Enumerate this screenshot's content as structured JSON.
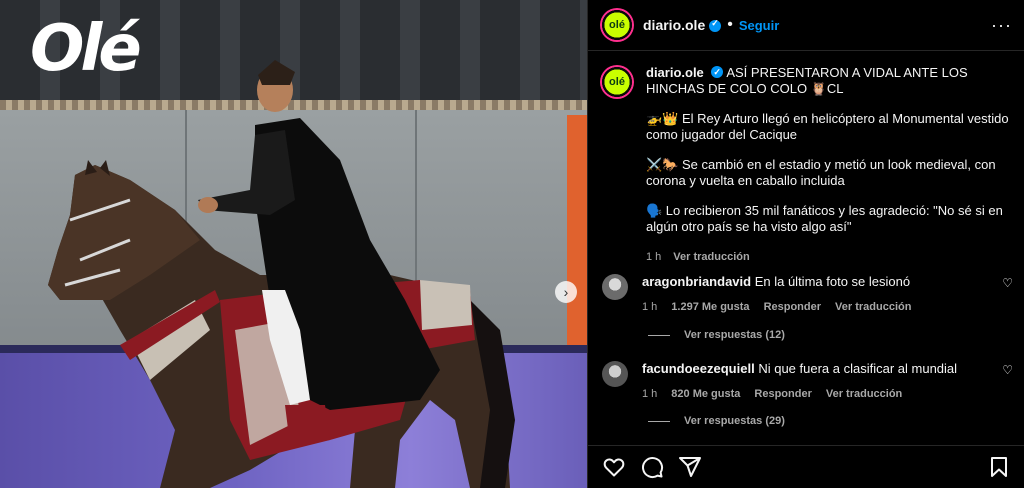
{
  "media": {
    "logo_text": "Olé"
  },
  "post": {
    "username": "diario.ole",
    "follow_label": "Seguir",
    "more_label": "···",
    "avatar_text": "olé",
    "caption": {
      "username": "diario.ole",
      "headline": "ASÍ PRESENTARON A VIDAL ANTE LOS HINCHAS DE COLO COLO 🦉CL",
      "paragraphs": [
        "🚁👑 El Rey Arturo llegó en helicóptero al Monumental vestido como jugador del Cacique",
        "⚔️🐎 Se cambió en el estadio y metió un look medieval, con corona y vuelta en caballo incluida",
        "🗣️ Lo recibieron 35 mil fanáticos y les agradeció: \"No sé si en algún otro país se ha visto algo así\""
      ],
      "time": "1 h",
      "see_translation": "Ver traducción"
    }
  },
  "comments": [
    {
      "username": "aragonbriandavid",
      "text": "En la última foto se lesionó",
      "time": "1 h",
      "likes": "1.297 Me gusta",
      "reply_label": "Responder",
      "translate_label": "Ver traducción",
      "replies_label": "Ver respuestas (12)"
    },
    {
      "username": "facundoeezequiell",
      "text": "Ni que fuera a clasificar al mundial",
      "time": "1 h",
      "likes": "820 Me gusta",
      "reply_label": "Responder",
      "translate_label": "Ver traducción",
      "replies_label": "Ver respuestas (29)"
    }
  ],
  "icons": {
    "like": "heart-icon",
    "comment": "comment-icon",
    "share": "share-icon",
    "save": "bookmark-icon",
    "next": "chevron-right-icon"
  },
  "colors": {
    "accent": "#0095f6",
    "background": "#000000",
    "muted": "#a8a8a8"
  }
}
